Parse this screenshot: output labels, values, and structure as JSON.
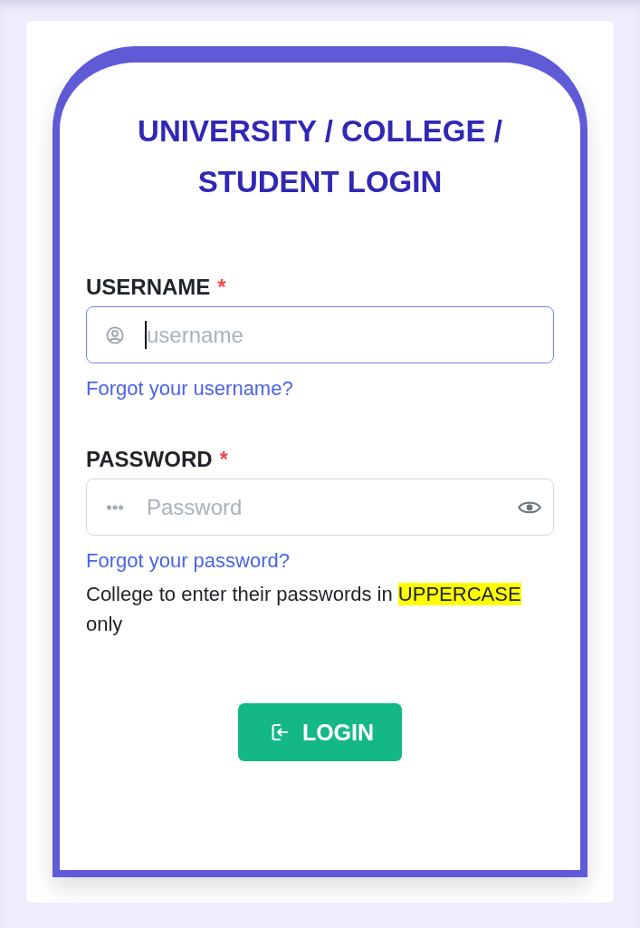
{
  "title": "UNIVERSITY / COLLEGE / STUDENT LOGIN",
  "fields": [
    {
      "kind": "text",
      "label": "USERNAME",
      "required_mark": "*",
      "placeholder": "username",
      "focused": true,
      "link": "Forgot your username?"
    },
    {
      "kind": "password",
      "label": "PASSWORD",
      "required_mark": "*",
      "placeholder": "Password",
      "focused": false,
      "link": "Forgot your password?"
    }
  ],
  "note": [
    {
      "text": "College to enter their passwords in",
      "highlighted": false
    },
    {
      "text": "UPPERCASE",
      "highlighted": true
    },
    {
      "text": "only",
      "highlighted": false
    }
  ],
  "login_button": {
    "label": "LOGIN"
  }
}
